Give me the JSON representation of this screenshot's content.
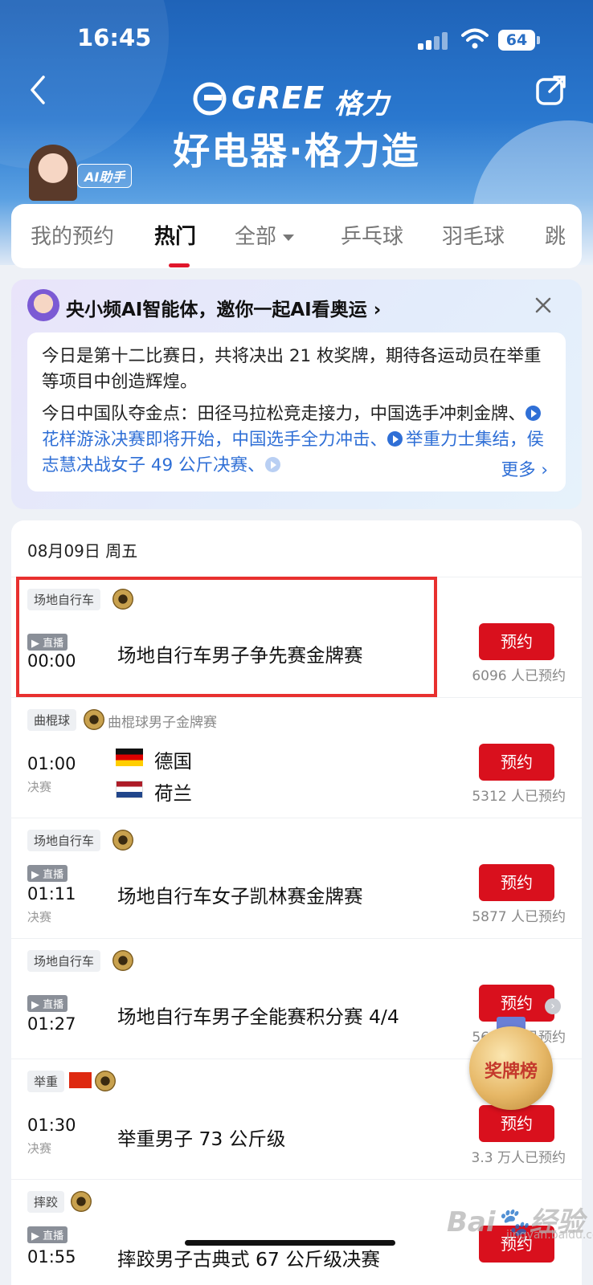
{
  "status_bar": {
    "time": "16:45",
    "battery": "64"
  },
  "header": {
    "brand_word": "GREE",
    "brand_cn": "格力",
    "slogan": "好电器·格力造",
    "ai_badge": "AI助手"
  },
  "tabs": [
    {
      "label": "我的预约"
    },
    {
      "label": "热门"
    },
    {
      "label": "全部"
    },
    {
      "label": "乒乓球"
    },
    {
      "label": "羽毛球"
    },
    {
      "label": "跳"
    }
  ],
  "ai_card": {
    "title": "央小频AI智能体，邀你一起AI看奥运 ›",
    "para1": "今日是第十二比赛日，共将决出 21 枚奖牌，期待各运动员在举重等项目中创造辉煌。",
    "para2_lead": "今日中国队夺金点：田径马拉松竞走接力，中国选手冲刺金牌、",
    "link1": "花样游泳决赛即将开始，中国选手全力冲击、",
    "link2": "举重力士集结，侯志慧决战女子 49 公斤决赛、",
    "more": "更多 ›"
  },
  "schedule": {
    "date": "08月09日 周五",
    "events": [
      {
        "tag": "场地自行车",
        "sub": "",
        "live": "▶ 直播",
        "time": "00:00",
        "stage": "",
        "name": "场地自行车男子争先赛金牌赛",
        "button": "预约",
        "count": "6096 人已预约"
      },
      {
        "tag": "曲棍球",
        "sub": "曲棍球男子金牌赛",
        "live": "",
        "time": "01:00",
        "stage": "决赛",
        "team1": "德国",
        "team2": "荷兰",
        "button": "预约",
        "count": "5312 人已预约"
      },
      {
        "tag": "场地自行车",
        "sub": "",
        "live": "▶ 直播",
        "time": "01:11",
        "stage": "决赛",
        "name": "场地自行车女子凯林赛金牌赛",
        "button": "预约",
        "count": "5877 人已预约"
      },
      {
        "tag": "场地自行车",
        "sub": "",
        "live": "▶ 直播",
        "time": "01:27",
        "stage": "",
        "name": "场地自行车男子全能赛积分赛 4/4",
        "button": "预约",
        "count": "5606 人已预约"
      },
      {
        "tag": "举重",
        "sub": "",
        "live": "",
        "time": "01:30",
        "stage": "决赛",
        "name": "举重男子 73 公斤级",
        "button": "预约",
        "count": "3.3 万人已预约"
      },
      {
        "tag": "摔跤",
        "sub": "",
        "live": "▶ 直播",
        "time": "01:55",
        "stage": "",
        "name": "摔跤男子古典式 67 公斤级决赛",
        "button": "预约",
        "count": ""
      }
    ]
  },
  "floating": {
    "medal_label": "奖牌榜"
  },
  "watermark": {
    "main": "Bai🐾经验",
    "sub": "jingyan.baidu.com"
  }
}
